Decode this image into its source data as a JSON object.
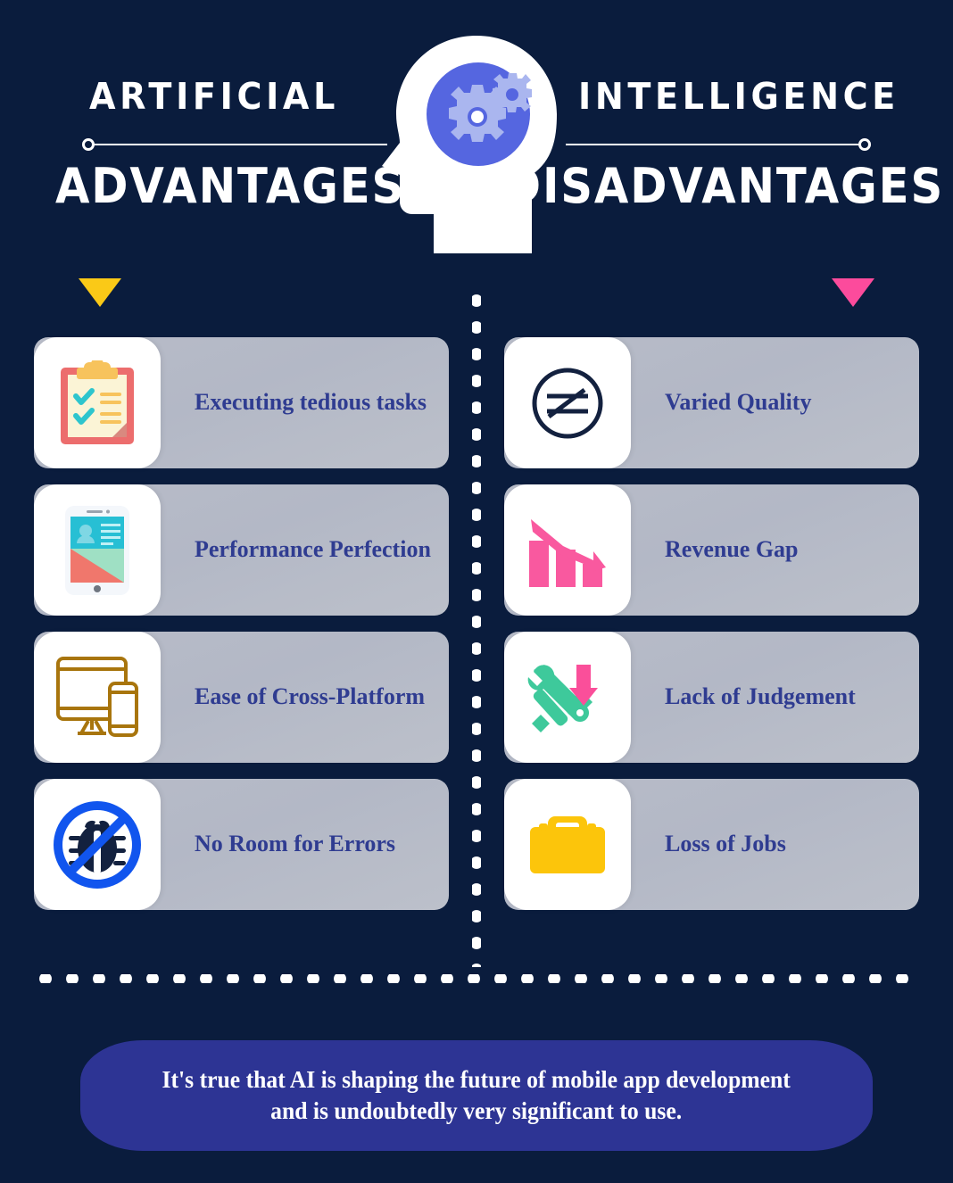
{
  "header": {
    "kicker_left": "ARTIFICIAL",
    "kicker_right": "INTELLIGENCE",
    "subtitle_left": "ADVANTAGES",
    "subtitle_right": "DISADVANTAGES",
    "center_icon": "head-with-gears-icon"
  },
  "colors": {
    "background": "#0a1c3d",
    "card_bg": "#b8bcc8",
    "card_text": "#2f3c91",
    "banner_bg": "#2d3494",
    "accent_yellow": "#fac917",
    "accent_pink": "#fc4b9c",
    "brain_blue": "#5566e0",
    "white": "#ffffff"
  },
  "advantages": {
    "marker_icon": "triangle-down-icon",
    "marker_color": "#fac917",
    "items": [
      {
        "label": "Executing tedious tasks",
        "icon": "clipboard-checklist-icon"
      },
      {
        "label": "Performance Perfection",
        "icon": "smartphone-profile-icon"
      },
      {
        "label": "Ease of Cross-Platform",
        "icon": "monitor-and-phone-icon"
      },
      {
        "label": "No Room for Errors",
        "icon": "no-bug-icon"
      }
    ]
  },
  "disadvantages": {
    "marker_icon": "triangle-down-icon",
    "marker_color": "#fc4b9c",
    "items": [
      {
        "label": "Varied Quality",
        "icon": "not-equal-circle-icon"
      },
      {
        "label": "Revenue Gap",
        "icon": "declining-bar-chart-icon"
      },
      {
        "label": "Lack of Judgement",
        "icon": "tools-down-arrow-icon"
      },
      {
        "label": "Loss of Jobs",
        "icon": "briefcase-icon"
      }
    ]
  },
  "banner": {
    "line1": "It's true that AI is shaping the future of mobile app development",
    "line2": "and is undoubtedly very significant to use."
  }
}
